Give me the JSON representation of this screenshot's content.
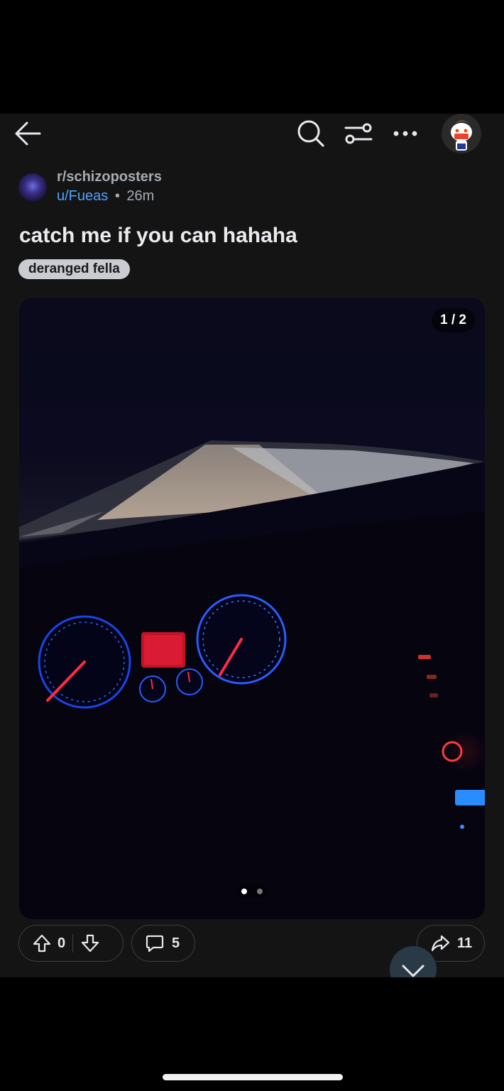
{
  "post": {
    "subreddit": "r/schizoposters",
    "author": "u/Fueas",
    "separator": "•",
    "age": "26m",
    "title": "catch me if you can hahaha",
    "flair": "deranged fella"
  },
  "media": {
    "counter": "1 / 2",
    "total_pages": 2,
    "current_page": 1
  },
  "actions": {
    "score": "0",
    "comments": "5",
    "shares": "11"
  },
  "icons": {
    "back": "arrow-left-icon",
    "search": "search-icon",
    "filter": "sliders-icon",
    "more": "more-horizontal-icon",
    "upvote": "arrow-up-icon",
    "downvote": "arrow-down-icon",
    "comment": "comment-bubble-icon",
    "share": "share-arrow-icon",
    "scroll": "chevron-down-icon"
  },
  "colors": {
    "background": "#141414",
    "username": "#4fa3ff",
    "flair_bg": "#c9ccd1",
    "text": "#e6e8eb"
  }
}
